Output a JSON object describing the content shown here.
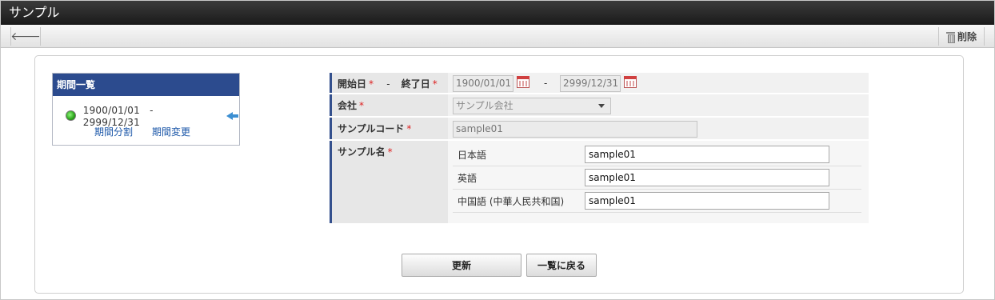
{
  "window": {
    "title": "サンプル"
  },
  "toolbar": {
    "back_icon": "arrow-left-icon",
    "delete_label": "削除",
    "delete_icon": "trash-icon"
  },
  "period_list": {
    "title": "期間一覧",
    "status_color": "#2aa31a",
    "range": "1900/01/01　-　2999/12/31",
    "links": {
      "split": "期間分割",
      "change": "期間変更"
    }
  },
  "form": {
    "required_mark": "*",
    "period": {
      "start_label": "開始日",
      "separator": "-",
      "end_label": "終了日",
      "start_value": "1900/01/01",
      "end_value": "2999/12/31",
      "value_separator": "-"
    },
    "company": {
      "label": "会社",
      "value": "サンプル会社"
    },
    "sample_code": {
      "label": "サンプルコード",
      "value": "sample01"
    },
    "sample_name": {
      "label": "サンプル名",
      "languages": [
        {
          "label": "日本語",
          "value": "sample01"
        },
        {
          "label": "英語",
          "value": "sample01"
        },
        {
          "label": "中国語 (中華人民共和国)",
          "value": "sample01"
        }
      ]
    }
  },
  "buttons": {
    "update": "更新",
    "back_to_list": "一覧に戻る"
  },
  "colors": {
    "header_bar": "#1a1a1a",
    "accent_blue": "#2c4b8e",
    "required": "#dd2222",
    "link": "#1a56a8"
  }
}
